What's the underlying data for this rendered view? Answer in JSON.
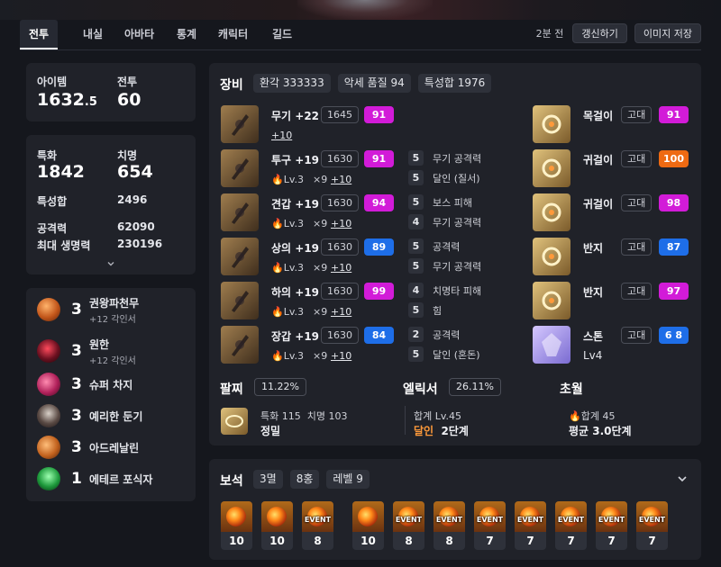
{
  "nav": {
    "tabs": [
      "전투",
      "내실",
      "아바타",
      "통계",
      "캐릭터",
      "길드"
    ],
    "time_ago": "2분 전",
    "refresh_label": "갱신하기",
    "save_image_label": "이미지 저장"
  },
  "summary": {
    "item_level_label": "아이템",
    "item_level_main": "1632",
    "item_level_dec": ".5",
    "combat_label": "전투",
    "combat_value": "60"
  },
  "stats": {
    "crit_label": "특화",
    "crit_value": "1842",
    "swift_label": "치명",
    "swift_value": "654",
    "total_label": "특성합",
    "total_value": "2496",
    "atk_label": "공격력",
    "atk_value": "62090",
    "hp_label": "최대 생명력",
    "hp_value": "230196"
  },
  "engravings": [
    {
      "level": "3",
      "name": "권왕파천무",
      "sub": "+12 각인서",
      "icon": "fist-engraving-icon"
    },
    {
      "level": "3",
      "name": "원한",
      "sub": "+12 각인서",
      "icon": "grudge-engraving-icon"
    },
    {
      "level": "3",
      "name": "슈퍼 차지",
      "sub": "",
      "icon": "super-charge-engraving-icon"
    },
    {
      "level": "3",
      "name": "예리한 둔기",
      "sub": "",
      "icon": "keen-blunt-engraving-icon"
    },
    {
      "level": "3",
      "name": "아드레날린",
      "sub": "",
      "icon": "adrenaline-engraving-icon"
    },
    {
      "level": "1",
      "name": "에테르 포식자",
      "sub": "",
      "icon": "ether-predator-engraving-icon"
    }
  ],
  "equipment": {
    "title": "장비",
    "chips": [
      "환각 333333",
      "악세 품질 94",
      "특성합 1976"
    ],
    "gear": [
      {
        "name": "무기 +22",
        "ilvl": "1645",
        "quality": "91",
        "qcolor": "magenta",
        "sub_level": "",
        "sub_mult": "",
        "plus": "+10",
        "traits": []
      },
      {
        "name": "투구 +19",
        "ilvl": "1630",
        "quality": "91",
        "qcolor": "magenta",
        "sub_level": "Lv.3",
        "sub_mult": "×9",
        "plus": "+10",
        "traits": [
          {
            "n": "5",
            "t": "무기 공격력"
          },
          {
            "n": "5",
            "t": "달인 (질서)"
          }
        ]
      },
      {
        "name": "견갑 +19",
        "ilvl": "1630",
        "quality": "94",
        "qcolor": "magenta",
        "sub_level": "Lv.3",
        "sub_mult": "×9",
        "plus": "+10",
        "traits": [
          {
            "n": "5",
            "t": "보스 피해"
          },
          {
            "n": "4",
            "t": "무기 공격력"
          }
        ]
      },
      {
        "name": "상의 +19",
        "ilvl": "1630",
        "quality": "89",
        "qcolor": "blue",
        "sub_level": "Lv.3",
        "sub_mult": "×9",
        "plus": "+10",
        "traits": [
          {
            "n": "5",
            "t": "공격력"
          },
          {
            "n": "5",
            "t": "무기 공격력"
          }
        ]
      },
      {
        "name": "하의 +19",
        "ilvl": "1630",
        "quality": "99",
        "qcolor": "magenta",
        "sub_level": "Lv.3",
        "sub_mult": "×9",
        "plus": "+10",
        "traits": [
          {
            "n": "4",
            "t": "치명타 피해"
          },
          {
            "n": "5",
            "t": "힘"
          }
        ]
      },
      {
        "name": "장갑 +19",
        "ilvl": "1630",
        "quality": "84",
        "qcolor": "blue",
        "sub_level": "Lv.3",
        "sub_mult": "×9",
        "plus": "+10",
        "traits": [
          {
            "n": "2",
            "t": "공격력"
          },
          {
            "n": "5",
            "t": "달인 (혼돈)"
          }
        ]
      }
    ],
    "accessories": [
      {
        "name": "목걸이",
        "tier": "고대",
        "quality": "91",
        "qcolor": "magenta"
      },
      {
        "name": "귀걸이",
        "tier": "고대",
        "quality": "100",
        "qcolor": "orange"
      },
      {
        "name": "귀걸이",
        "tier": "고대",
        "quality": "98",
        "qcolor": "magenta"
      },
      {
        "name": "반지",
        "tier": "고대",
        "quality": "87",
        "qcolor": "blue"
      },
      {
        "name": "반지",
        "tier": "고대",
        "quality": "97",
        "qcolor": "magenta"
      },
      {
        "name": "스톤",
        "tier": "고대",
        "quality": "6 8",
        "qcolor": "blue",
        "extra": "Lv4"
      }
    ],
    "bracelet": {
      "title": "팔찌",
      "pct": "11.22%",
      "stat1": "특화 115",
      "stat2": "치명 103",
      "effect": "정밀"
    },
    "elixir": {
      "title": "엘릭서",
      "pct": "26.11%",
      "line1": "합계 Lv.45",
      "line2_a": "달인",
      "line2_b": "2단계"
    },
    "transcend": {
      "title": "초월",
      "line1": "합계 45",
      "line2": "평균 3.0단계"
    }
  },
  "gems": {
    "title": "보석",
    "chips": [
      "3멸",
      "8홍",
      "레벨 9"
    ],
    "items": [
      {
        "level": "10",
        "event": ""
      },
      {
        "level": "10",
        "event": ""
      },
      {
        "level": "8",
        "event": "EVENT"
      },
      {
        "level": "10",
        "event": ""
      },
      {
        "level": "8",
        "event": "EVENT"
      },
      {
        "level": "8",
        "event": "EVENT"
      },
      {
        "level": "7",
        "event": "EVENT"
      },
      {
        "level": "7",
        "event": "EVENT"
      },
      {
        "level": "7",
        "event": "EVENT"
      },
      {
        "level": "7",
        "event": "EVENT"
      },
      {
        "level": "7",
        "event": "EVENT"
      }
    ]
  }
}
